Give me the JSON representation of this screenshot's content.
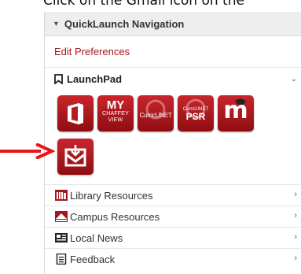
{
  "caption": "Click on the Gmail icon on the",
  "panel": {
    "title": "QuickLaunch Navigation",
    "edit_preferences": "Edit Preferences",
    "launchpad": {
      "title": "LaunchPad",
      "tiles": [
        {
          "name": "Office 365",
          "icon": "office-icon"
        },
        {
          "name": "MyChaffeyView",
          "line1": "MY",
          "line2": "CHAFFEY",
          "line3": "VIEW"
        },
        {
          "name": "CurricUNET",
          "label": "CurricUNET"
        },
        {
          "name": "CurricUNET PSR",
          "top": "CurricUNET",
          "label": "PSR"
        },
        {
          "name": "Moodle",
          "label": "m"
        },
        {
          "name": "Gmail",
          "icon": "gmail-icon"
        }
      ]
    },
    "links": [
      {
        "label": "Library Resources",
        "icon": "library-icon"
      },
      {
        "label": "Campus Resources",
        "icon": "campus-icon"
      },
      {
        "label": "Local News",
        "icon": "news-icon"
      },
      {
        "label": "Feedback",
        "icon": "feedback-icon"
      }
    ]
  },
  "colors": {
    "brand_red": "#a8141d",
    "tile_red": "#b91d23",
    "arrow_red": "#e8141a"
  }
}
